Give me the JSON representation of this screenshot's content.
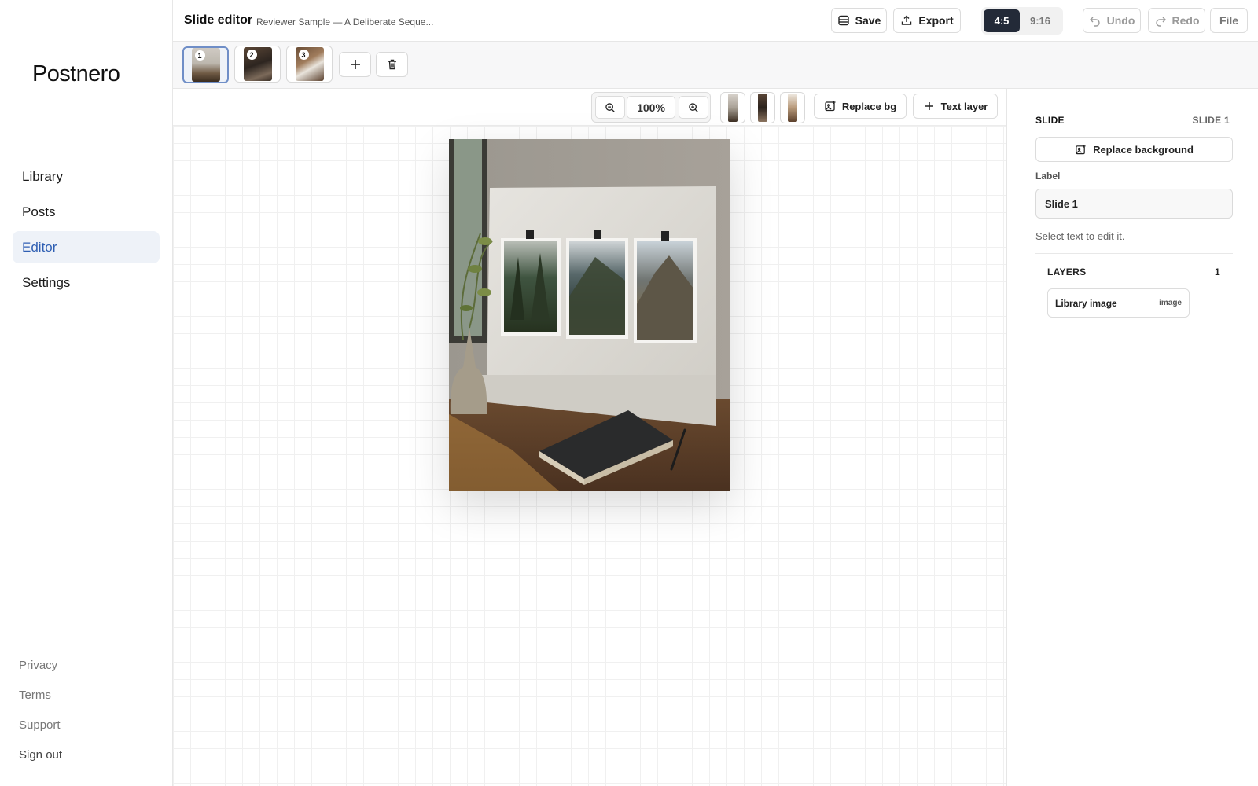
{
  "brand": "Postnero",
  "nav": {
    "items": [
      {
        "label": "Library"
      },
      {
        "label": "Posts"
      },
      {
        "label": "Editor"
      },
      {
        "label": "Settings"
      }
    ],
    "active": "Editor"
  },
  "footer": {
    "privacy": "Privacy",
    "terms": "Terms",
    "support": "Support",
    "signout": "Sign out"
  },
  "header": {
    "title": "Slide editor",
    "subtitle": "Reviewer Sample — A Deliberate Seque...",
    "save": "Save",
    "export": "Export",
    "ratios": [
      "4:5",
      "9:16"
    ],
    "active_ratio": "4:5",
    "undo": "Undo",
    "redo": "Redo",
    "file": "File"
  },
  "slides": {
    "items": [
      {
        "num": "1",
        "selected": true
      },
      {
        "num": "2",
        "selected": false
      },
      {
        "num": "3",
        "selected": false
      }
    ]
  },
  "canvas_toolbar": {
    "zoom": "100%",
    "replace_bg": "Replace bg",
    "text_layer": "Text layer"
  },
  "inspector": {
    "section": "SLIDE",
    "section_value": "SLIDE 1",
    "replace_background": "Replace background",
    "label_title": "Label",
    "label_value": "Slide 1",
    "hint": "Select text to edit it.",
    "layers_title": "LAYERS",
    "layers_count": "1",
    "layers": [
      {
        "name": "Library image",
        "type": "image"
      }
    ]
  },
  "colors": {
    "accent": "#2f5fb3",
    "active_nav_bg": "#eef2f8",
    "segment_active": "#232a38"
  }
}
